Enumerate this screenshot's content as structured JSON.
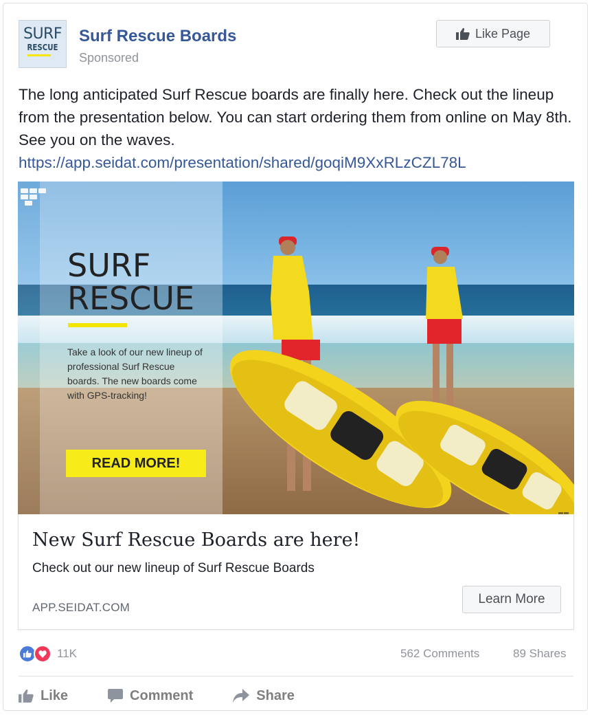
{
  "post": {
    "page_name": "Surf Rescue Boards",
    "sponsored_label": "Sponsored",
    "avatar": {
      "line1": "SURF",
      "line2": "RESCUE"
    },
    "like_page_label": "Like Page",
    "text": "The long anticipated Surf Rescue boards are finally here. Check out the lineup from the presentation below. You can start ordering them from online on May 8th. See you on the waves.",
    "link_url": "https://app.seidat.com/presentation/shared/goqiM9XxRLzCZL78L"
  },
  "hero": {
    "title_line1": "SURF",
    "title_line2": "RESCUE",
    "description": "Take a look of our new lineup of professional Surf Rescue boards. The new boards come with GPS-tracking!",
    "button_label": "READ MORE!",
    "accent_color": "#f7ec1a"
  },
  "link_preview": {
    "title": "New Surf Rescue Boards are here!",
    "description": "Check out our new lineup of Surf Rescue Boards",
    "domain": "APP.SEIDAT.COM",
    "cta_label": "Learn More"
  },
  "engagement": {
    "reaction_icons": [
      "like-icon",
      "love-icon"
    ],
    "reaction_count": "11K",
    "comments": "562 Comments",
    "shares": "89 Shares"
  },
  "actions": {
    "like": "Like",
    "comment": "Comment",
    "share": "Share"
  },
  "colors": {
    "link_blue": "#365899",
    "like_blue": "#4a7bd8",
    "love_red": "#f0385b"
  }
}
